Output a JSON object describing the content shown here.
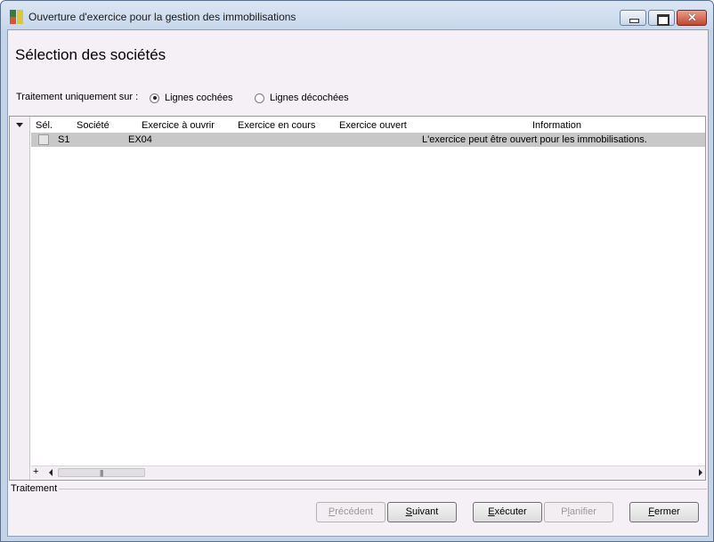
{
  "window": {
    "title": "Ouverture d'exercice pour la gestion des immobilisations",
    "icon": "app-icon",
    "controls": [
      "minimize",
      "maximize",
      "close"
    ]
  },
  "page": {
    "heading": "Sélection des sociétés",
    "processing_mode": {
      "label": "Traitement uniquement sur :",
      "options": [
        {
          "label": "Lignes cochées",
          "selected": true
        },
        {
          "label": "Lignes décochées",
          "selected": false
        }
      ]
    }
  },
  "grid": {
    "columns": [
      "Sél.",
      "Société",
      "Exercice à ouvrir",
      "Exercice en cours",
      "Exercice ouvert",
      "Information"
    ],
    "rows": [
      {
        "selected": false,
        "societe": "S1",
        "exercice_a_ouvrir": "EX04",
        "exercice_en_cours": "",
        "exercice_ouvert": "",
        "information": "L'exercice peut être ouvert pour les immobilisations."
      }
    ],
    "scroll": {
      "plus": "+"
    }
  },
  "footer": {
    "section_label": "Traitement",
    "buttons": {
      "previous": {
        "prefix": "",
        "underline": "P",
        "suffix": "récédent",
        "enabled": false
      },
      "next": {
        "prefix": "",
        "underline": "S",
        "suffix": "uivant",
        "enabled": true
      },
      "execute": {
        "prefix": "",
        "underline": "E",
        "suffix": "xécuter",
        "enabled": true
      },
      "schedule": {
        "prefix": "P",
        "underline": "l",
        "suffix": "anifier",
        "enabled": false
      },
      "close": {
        "prefix": "",
        "underline": "F",
        "suffix": "ermer",
        "enabled": true
      }
    }
  },
  "colors": {
    "window_frame": "#c4d3e6",
    "client_background": "#f5eff6",
    "selected_row": "#c8c8c8",
    "close_button": "#c5452f"
  }
}
